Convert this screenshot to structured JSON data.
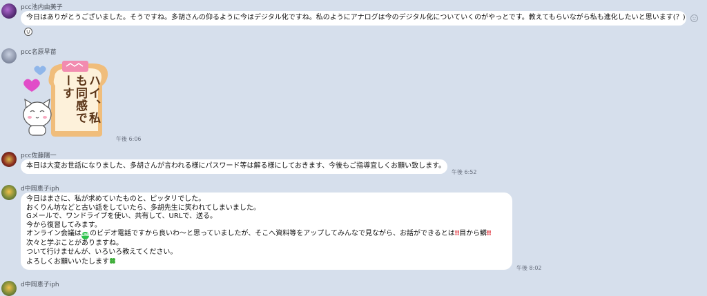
{
  "messages": [
    {
      "sender": "pcc池内由美子",
      "lines": [
        "今日はありがとうございました。そうですね。多胡さんの仰るように今はデジタル化ですね。私のようにアナログは今のデジタル化についていくのがやっとです。教えてもらいながら私も進化したいと思います(？)"
      ]
    },
    {
      "sender": "pcc名原早苗",
      "sticker_text": [
        "ハイ、私",
        "も同感で",
        "ーす"
      ],
      "time": "午後 6:06"
    },
    {
      "sender": "pcc佐藤陽一",
      "lines": [
        "本日は大変お世話になりました、多胡さんが言われる様にパスワード等は解る様にしておきます、今後もご指導宜しくお願い致します。"
      ],
      "time": "午後 6:52"
    },
    {
      "sender": "d中岡恵子iph",
      "lines": [
        "今日はまさに、私が求めていたものと、ピッタリでした。",
        "おくりん坊などと古い話をしていたら、多胡先生に笑われてしまいました。",
        "Gメールで、ワンドライブを使い、共有して、URLで、送る。",
        "今から復習してみます。",
        "次々と学ぶことがありますね。",
        "ついて行けませんが、いろいろ教えてください。",
        "よろしくお願いいたします"
      ],
      "line5": {
        "pre": "オンライン会議は",
        "badge": "LINE",
        "mid": "のビデオ電話ですから良いわ〜と思っていましたが、そこへ資料等をアップしてみんなで見ながら、お話ができるとは",
        "bang1": "‼",
        "post": "目から鱗",
        "bang2": "‼"
      },
      "time": "午後 8:02"
    },
    {
      "sender": "d中岡恵子iph"
    }
  ],
  "icons": {
    "reaction": "smiley-react-icon",
    "sub_reaction": "emoji-reaction-icon",
    "clover": "four-leaf-clover-icon"
  },
  "colors": {
    "background": "#d6dfec",
    "bubble": "#ffffff",
    "line_green": "#2bc24a",
    "alert_red": "#e0303a"
  }
}
